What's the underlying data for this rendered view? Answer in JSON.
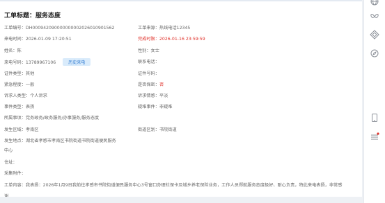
{
  "ticket": {
    "title": "工单标题：服务态度",
    "rows": [
      {
        "left": "工单编号：DH000942090000000002026010901562",
        "right": "工单来源：热线电话12345"
      },
      {
        "left": "来电时间：2026-01-09 17:20:51",
        "right": "完成时限：2026-01-16 23:59:59"
      },
      {
        "left": "姓名：陈",
        "right": "性别：女士"
      },
      {
        "left": "来电号码：13789967106",
        "right": "联系电话："
      },
      {
        "left": "证件类型：其他",
        "right": "证件号码："
      },
      {
        "left": "紧急程度：一般",
        "right_label": "是否保密：",
        "right_value": "否"
      },
      {
        "left": "诉求人类型：个人诉求",
        "right": "诉求情感：平淡"
      },
      {
        "left": "事件类型：表扬",
        "right": "疑难事件：非疑难"
      },
      {
        "left": "所属事项：党务政务/政务服务/办事服务/服务态度"
      },
      {
        "left": "发生区域：孝南区",
        "right": "街道区划：书院街道"
      },
      {
        "left": "发生地点：湖北省孝感市孝南区书院街道书院街道便民服务"
      }
    ],
    "location_cont": "中心",
    "address": "住址：",
    "attachments": "采集附件：",
    "content": "工单内容：我表扬：2026年1月9日我前往孝感市书院街道便民服务中心3号窗口办理社保卡及城乡养老保险业务，工作人员郑航服务态度极好、耐心负责，特此来电表扬，非常感",
    "content_cont": "谢",
    "history_button": "历史来电"
  },
  "colors": {
    "deadline": "#e0322b",
    "secret": "#e0322b",
    "button_bg": "#d9ebfb",
    "button_text": "#2f7ad1"
  },
  "rail_icons": [
    "globe-icon",
    "butterfly-icon",
    "diamond-icon",
    "compass-icon",
    "phone-icon",
    "menu-icon"
  ]
}
